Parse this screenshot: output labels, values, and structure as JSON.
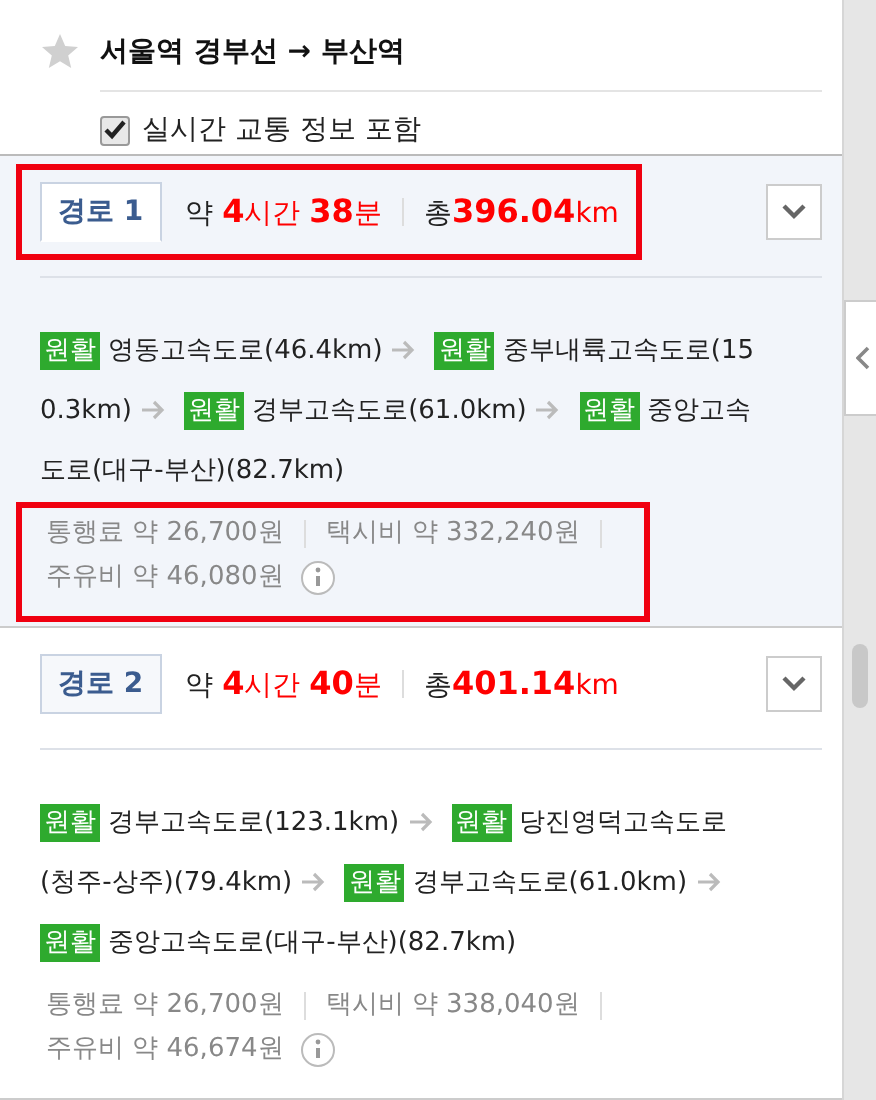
{
  "header": {
    "favorite": false,
    "title": "서울역 경부선 → 부산역",
    "realtime": {
      "label": "실시간 교통 정보 포함",
      "checked": true
    }
  },
  "routes": [
    {
      "tab": "경로 1",
      "selected": true,
      "highlighted": true,
      "duration": {
        "prefix": "약",
        "hours": "4",
        "hour_unit": "시간",
        "minutes": "38",
        "minute_unit": "분"
      },
      "distance": {
        "prefix": "총",
        "value": "396.04",
        "unit": "km"
      },
      "expanded": false,
      "segments": [
        {
          "status": "원활",
          "color": "#2eaa2e",
          "road_lines": [
            "영동고속도로(46.4km)"
          ]
        },
        {
          "status": "원활",
          "color": "#2eaa2e",
          "road_lines": [
            "중부내륙고속도로(15",
            "0.3km)"
          ]
        },
        {
          "status": "원활",
          "color": "#2eaa2e",
          "road_lines": [
            "경부고속도로(61.0km)"
          ]
        },
        {
          "status": "원활",
          "color": "#2eaa2e",
          "road_lines": [
            "중앙고속",
            "도로(대구-부산)(82.7km)"
          ]
        }
      ],
      "costs_highlighted": true,
      "costs": [
        "통행료 약 26,700원",
        "택시비 약 332,240원",
        "주유비 약 46,080원"
      ]
    },
    {
      "tab": "경로 2",
      "selected": false,
      "highlighted": false,
      "duration": {
        "prefix": "약",
        "hours": "4",
        "hour_unit": "시간",
        "minutes": "40",
        "minute_unit": "분"
      },
      "distance": {
        "prefix": "총",
        "value": "401.14",
        "unit": "km"
      },
      "expanded": false,
      "segments": [
        {
          "status": "원활",
          "color": "#2eaa2e",
          "road_lines": [
            "경부고속도로(123.1km)"
          ]
        },
        {
          "status": "원활",
          "color": "#2eaa2e",
          "road_lines": [
            "당진영덕고속도로",
            "(청주-상주)(79.4km)"
          ]
        },
        {
          "status": "원활",
          "color": "#2eaa2e",
          "road_lines": [
            "경부고속도로(61.0km)"
          ]
        },
        {
          "status": "원활",
          "color": "#2eaa2e",
          "road_lines": [
            "중앙고속도로(대구-부산)(82.7km)"
          ]
        }
      ],
      "costs_highlighted": false,
      "costs": [
        "통행료 약 26,700원",
        "택시비 약 338,040원",
        "주유비 약 46,674원"
      ]
    }
  ]
}
